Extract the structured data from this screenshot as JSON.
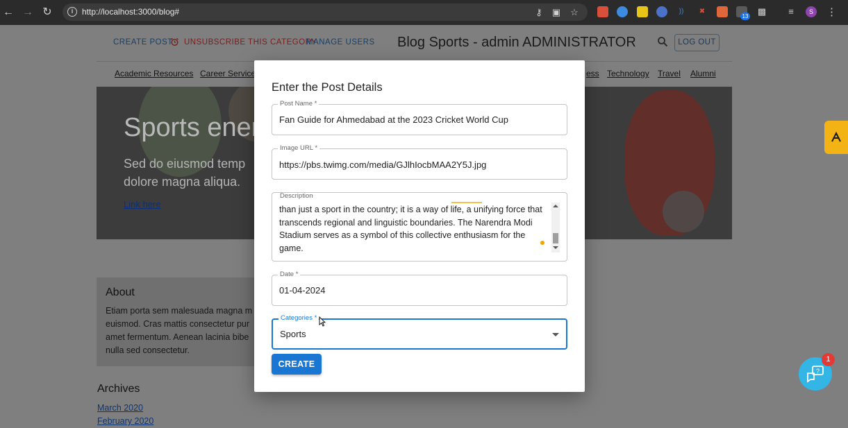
{
  "browser": {
    "url": "http://localhost:3000/blog#",
    "extension_badge": "13",
    "profile_initial": "S"
  },
  "header": {
    "links": [
      {
        "label": "CREATE POST"
      },
      {
        "label": "UNSUBSCRIBE THIS CATEGORY"
      },
      {
        "label": "MANAGE USERS"
      }
    ],
    "title": "Blog Sports - admin ADMINISTRATOR",
    "logout_label": "LOG OUT"
  },
  "categories_nav": {
    "items": [
      "Academic Resources",
      "Career Services",
      "ess",
      "Technology",
      "Travel",
      "Alumni"
    ]
  },
  "hero": {
    "title": "Sports ener",
    "text": "Sed do eiusmod temp dolore magna aliqua.",
    "link": "Link here"
  },
  "about": {
    "title": "About",
    "text": "Etiam porta sem malesuada magna m euismod. Cras mattis consectetur pur amet fermentum. Aenean lacinia bibe nulla sed consectetur."
  },
  "archives": {
    "title": "Archives",
    "items": [
      "March 2020",
      "February 2020"
    ]
  },
  "chat": {
    "badge_count": "1"
  },
  "modal": {
    "title": "Enter the Post Details",
    "fields": {
      "post_name": {
        "label": "Post Name *",
        "value": "Fan Guide for Ahmedabad at the 2023 Cricket World Cup"
      },
      "image_url": {
        "label": "Image URL *",
        "value": "https://pbs.twimg.com/media/GJlhIocbMAA2Y5J.jpg"
      },
      "description": {
        "label": "Description",
        "value": "than just a sport in the country; it is a way of life, a unifying force that transcends regional and linguistic boundaries. The Narendra Modi Stadium serves as a symbol of this collective enthusiasm for the game."
      },
      "date": {
        "label": "Date *",
        "value": "01-04-2024"
      },
      "categories": {
        "label": "Categories *",
        "value": "Sports"
      }
    },
    "submit_label": "CREATE"
  },
  "colors": {
    "primary": "#1976d2",
    "accent_yellow": "#f3b315",
    "chat_blue": "#33b5e5",
    "badge_red": "#e53935"
  }
}
